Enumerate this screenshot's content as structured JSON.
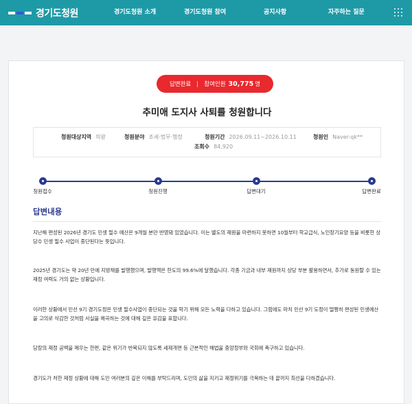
{
  "header": {
    "logo_text": "경기도청원",
    "nav": [
      "경기도청원 소개",
      "경기도청원 참여",
      "공지사항",
      "자주하는 질문"
    ],
    "brand_color": "#1e9aa6",
    "menu_icon": "grid-menu-icon"
  },
  "petition": {
    "status": "답변완료",
    "participants_label": "참여인원",
    "participants_count": "30,775",
    "participants_unit": "명",
    "title": "추미애 도지사 사퇴를 청원합니다",
    "meta": {
      "region_label": "청원대상지역",
      "region_value": "의왕",
      "field_label": "청원분야",
      "field_value": "조세·법무·행정",
      "period_label": "청원기간",
      "period_value": "2026.09.11~2026.10.11",
      "author_label": "청원인",
      "author_value": "Naver-qk**",
      "views_label": "조회수",
      "views_value": "84,920"
    },
    "steps": [
      "청원접수",
      "청원진행",
      "답변대기",
      "답변완료"
    ],
    "accent_color": "#2a3a8f",
    "status_color": "#e8292e"
  },
  "answer": {
    "section_title": "답변내용",
    "paragraphs": [
      "지난해 편성된 2026년 경기도 민생 필수 예산은 9개월 분만 반영돼 있었습니다. 이는 별도의 재원을 마련하지 못하면 10월부터 학교급식, 노인장기요양 등을 비롯한 상당수 민생 필수 사업이 중단된다는 뜻입니다.",
      "2025년 경기도는 약 20년 만에 지방채를 발행했으며, 발행액은 한도의 99.6%에 달했습니다. 각종 기금과 내부 재원까지 상당 부분 활용하면서, 추가로 동원할 수 있는 재정 여력도 거의 없는 상황입니다.",
      "이러한 상황에서 민선 9기 경기도정은 민생 필수사업이 중단되는 것을 막기 위해 모든 노력을 다하고 있습니다. 그럼에도 마치 민선 9기 도정이 멀쩡히 편성된 민생예산을 고의로 삭감한 것처럼 사실을 왜곡하는 것에 대해 깊은 유감을 표합니다.",
      "당장의 재정 공백을 메우는 한편, 같은 위기가 반복되지 않도록 세제개편 등 근본적인 해법을 중앙정부와 국회에 촉구하고 있습니다.",
      "경기도가 처한 재정 상황에 대해 도민 여러분의 깊은 이해를 부탁드리며, 도민의 삶을 지키고 재정위기를 극복하는 데 끝까지 최선을 다하겠습니다."
    ]
  }
}
